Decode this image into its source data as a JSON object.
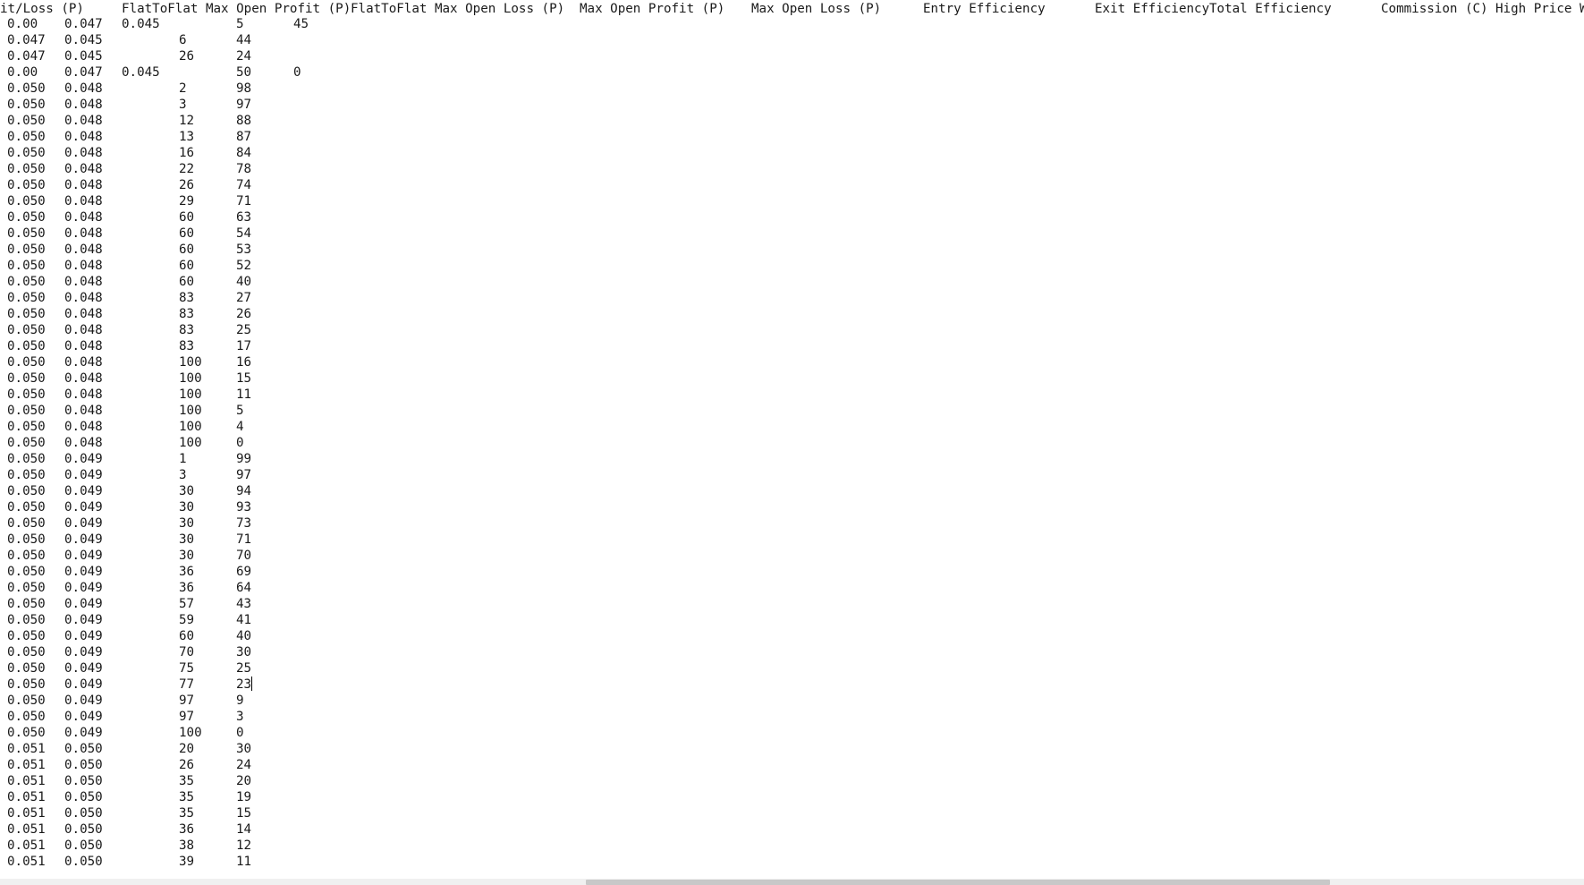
{
  "header": {
    "columns": [
      "it/Loss (P)",
      "FlatToFlat Max Open Profit (P)",
      "FlatToFlat Max Open Loss (P)",
      "Max Open Profit (P)",
      "Max Open Loss (P)",
      "Entry Efficiency",
      "Exit Efficiency",
      "Total Efficiency",
      "Commission (C)",
      "High Price W"
    ]
  },
  "rows": [
    [
      "0.00",
      "0.047",
      "0.045",
      "",
      "5",
      "45"
    ],
    [
      "0.047",
      "0.045",
      "",
      "6",
      "44",
      ""
    ],
    [
      "0.047",
      "0.045",
      "",
      "26",
      "24",
      ""
    ],
    [
      "0.00",
      "0.047",
      "0.045",
      "",
      "50",
      "0"
    ],
    [
      "0.050",
      "0.048",
      "",
      "2",
      "98",
      ""
    ],
    [
      "0.050",
      "0.048",
      "",
      "3",
      "97",
      ""
    ],
    [
      "0.050",
      "0.048",
      "",
      "12",
      "88",
      ""
    ],
    [
      "0.050",
      "0.048",
      "",
      "13",
      "87",
      ""
    ],
    [
      "0.050",
      "0.048",
      "",
      "16",
      "84",
      ""
    ],
    [
      "0.050",
      "0.048",
      "",
      "22",
      "78",
      ""
    ],
    [
      "0.050",
      "0.048",
      "",
      "26",
      "74",
      ""
    ],
    [
      "0.050",
      "0.048",
      "",
      "29",
      "71",
      ""
    ],
    [
      "0.050",
      "0.048",
      "",
      "60",
      "63",
      ""
    ],
    [
      "0.050",
      "0.048",
      "",
      "60",
      "54",
      ""
    ],
    [
      "0.050",
      "0.048",
      "",
      "60",
      "53",
      ""
    ],
    [
      "0.050",
      "0.048",
      "",
      "60",
      "52",
      ""
    ],
    [
      "0.050",
      "0.048",
      "",
      "60",
      "40",
      ""
    ],
    [
      "0.050",
      "0.048",
      "",
      "83",
      "27",
      ""
    ],
    [
      "0.050",
      "0.048",
      "",
      "83",
      "26",
      ""
    ],
    [
      "0.050",
      "0.048",
      "",
      "83",
      "25",
      ""
    ],
    [
      "0.050",
      "0.048",
      "",
      "83",
      "17",
      ""
    ],
    [
      "0.050",
      "0.048",
      "",
      "100",
      "16",
      ""
    ],
    [
      "0.050",
      "0.048",
      "",
      "100",
      "15",
      ""
    ],
    [
      "0.050",
      "0.048",
      "",
      "100",
      "11",
      ""
    ],
    [
      "0.050",
      "0.048",
      "",
      "100",
      "5",
      ""
    ],
    [
      "0.050",
      "0.048",
      "",
      "100",
      "4",
      ""
    ],
    [
      "0.050",
      "0.048",
      "",
      "100",
      "0",
      ""
    ],
    [
      "0.050",
      "0.049",
      "",
      "1",
      "99",
      ""
    ],
    [
      "0.050",
      "0.049",
      "",
      "3",
      "97",
      ""
    ],
    [
      "0.050",
      "0.049",
      "",
      "30",
      "94",
      ""
    ],
    [
      "0.050",
      "0.049",
      "",
      "30",
      "93",
      ""
    ],
    [
      "0.050",
      "0.049",
      "",
      "30",
      "73",
      ""
    ],
    [
      "0.050",
      "0.049",
      "",
      "30",
      "71",
      ""
    ],
    [
      "0.050",
      "0.049",
      "",
      "30",
      "70",
      ""
    ],
    [
      "0.050",
      "0.049",
      "",
      "36",
      "69",
      ""
    ],
    [
      "0.050",
      "0.049",
      "",
      "36",
      "64",
      ""
    ],
    [
      "0.050",
      "0.049",
      "",
      "57",
      "43",
      ""
    ],
    [
      "0.050",
      "0.049",
      "",
      "59",
      "41",
      ""
    ],
    [
      "0.050",
      "0.049",
      "",
      "60",
      "40",
      ""
    ],
    [
      "0.050",
      "0.049",
      "",
      "70",
      "30",
      ""
    ],
    [
      "0.050",
      "0.049",
      "",
      "75",
      "25",
      ""
    ],
    [
      "0.050",
      "0.049",
      "",
      "77",
      "23",
      ""
    ],
    [
      "0.050",
      "0.049",
      "",
      "97",
      "9",
      ""
    ],
    [
      "0.050",
      "0.049",
      "",
      "97",
      "3",
      ""
    ],
    [
      "0.050",
      "0.049",
      "",
      "100",
      "0",
      ""
    ],
    [
      "0.051",
      "0.050",
      "",
      "20",
      "30",
      ""
    ],
    [
      "0.051",
      "0.050",
      "",
      "26",
      "24",
      ""
    ],
    [
      "0.051",
      "0.050",
      "",
      "35",
      "20",
      ""
    ],
    [
      "0.051",
      "0.050",
      "",
      "35",
      "19",
      ""
    ],
    [
      "0.051",
      "0.050",
      "",
      "35",
      "15",
      ""
    ],
    [
      "0.051",
      "0.050",
      "",
      "36",
      "14",
      ""
    ],
    [
      "0.051",
      "0.050",
      "",
      "38",
      "12",
      ""
    ],
    [
      "0.051",
      "0.050",
      "",
      "39",
      "11",
      ""
    ]
  ],
  "caret_row": 41,
  "caret_col": 4,
  "scrollbar": {
    "horizontal_position_fraction": 0.37,
    "horizontal_visible_fraction": 0.47
  }
}
